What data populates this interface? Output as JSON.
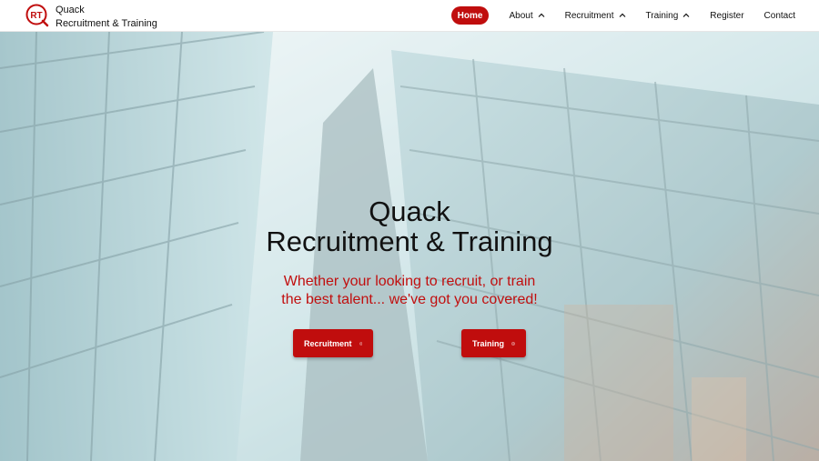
{
  "brand": {
    "logo_letters": "RT",
    "name_line1": "Quack",
    "name_line2": "Recruitment & Training"
  },
  "nav": {
    "items": [
      {
        "label": "Home",
        "active": true,
        "dropdown": false
      },
      {
        "label": "About",
        "active": false,
        "dropdown": true
      },
      {
        "label": "Recruitment",
        "active": false,
        "dropdown": true
      },
      {
        "label": "Training",
        "active": false,
        "dropdown": true
      },
      {
        "label": "Register",
        "active": false,
        "dropdown": false
      },
      {
        "label": "Contact",
        "active": false,
        "dropdown": false
      }
    ]
  },
  "hero": {
    "title_line1": "Quack",
    "title_line2": "Recruitment & Training",
    "subtitle_line1": "Whether your looking to recruit, or train",
    "subtitle_line2": "the best talent... we've got you covered!",
    "buttons": [
      {
        "label": "Recruitment",
        "icon": "arrow-circle-right-icon"
      },
      {
        "label": "Training",
        "icon": "arrow-circle-right-icon"
      }
    ]
  },
  "colors": {
    "accent": "#c00d0d",
    "text": "#111111",
    "header_bg": "#ffffff"
  }
}
